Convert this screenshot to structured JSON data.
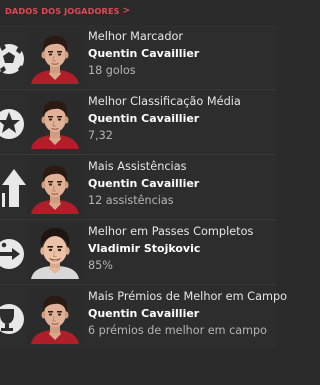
{
  "header": {
    "title": "DADOS DOS JOGADORES",
    "chevron": ">"
  },
  "colors": {
    "background": "#2a2a2a",
    "accent": "#e04a55",
    "text_primary": "#e6e6e6",
    "text_bold": "#ffffff",
    "text_secondary": "#b4b4b4"
  },
  "rows": [
    {
      "category": "Melhor Marcador",
      "player": "Quentin Cavaillier",
      "value": "18 golos",
      "icon": "football-icon",
      "avatar": "player-face-1"
    },
    {
      "category": "Melhor Classificação Média",
      "player": "Quentin Cavaillier",
      "value": "7,32",
      "icon": "rating-star-icon",
      "avatar": "player-face-1"
    },
    {
      "category": "Mais Assistências",
      "player": "Quentin Cavaillier",
      "value": "12 assistências",
      "icon": "assist-arrow-icon",
      "avatar": "player-face-1"
    },
    {
      "category": "Melhor em Passes Completos",
      "player": "Vladimir Stojkovic",
      "value": "85%",
      "icon": "pass-icon",
      "avatar": "player-face-2"
    },
    {
      "category": "Mais Prémios de Melhor em Campo",
      "player": "Quentin Cavaillier",
      "value": "6 prémios de melhor em campo",
      "icon": "award-icon",
      "avatar": "player-face-1"
    }
  ]
}
